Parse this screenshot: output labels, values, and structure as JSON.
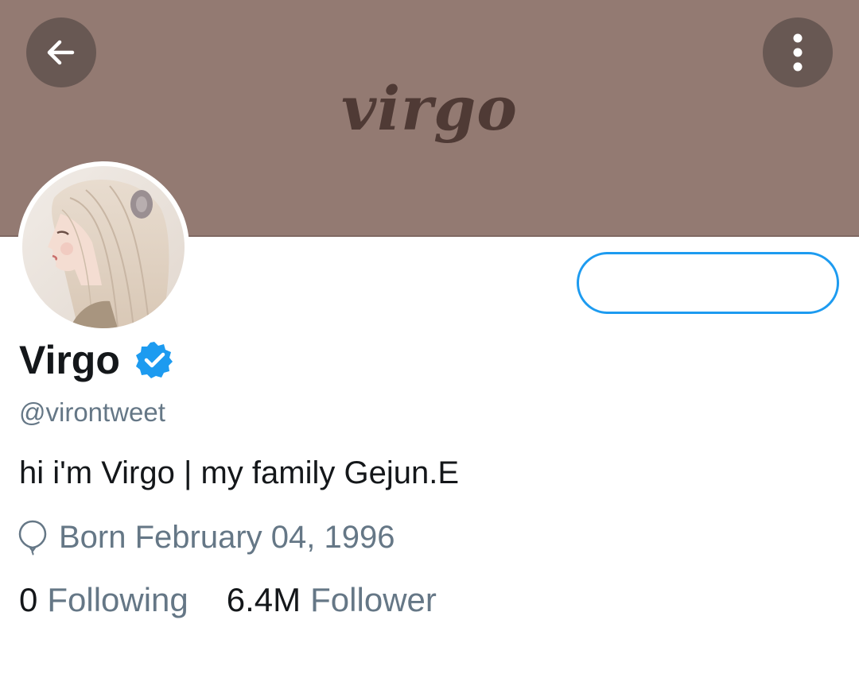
{
  "header": {
    "banner_text": "virgo",
    "back_icon": "arrow-left-icon",
    "more_icon": "vertical-dots-icon",
    "banner_color": "#937a72"
  },
  "profile": {
    "display_name": "Virgo",
    "verified_icon": "verified-badge-icon",
    "handle": "@virontweet",
    "bio": "hi i'm Virgo | my family Gejun.E",
    "birth_icon": "balloon-icon",
    "birth": "Born February 04, 1996",
    "follow_button_label": ""
  },
  "stats": {
    "following_count": "0",
    "following_label": "Following",
    "followers_count": "6.4M",
    "followers_label": "Follower"
  },
  "colors": {
    "accent": "#1d9bf0",
    "secondary_text": "#657786",
    "primary_text": "#14171a"
  }
}
